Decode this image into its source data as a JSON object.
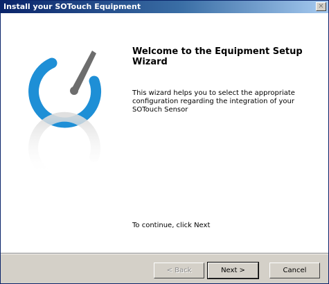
{
  "window": {
    "title": "Install your SOTouch Equipment",
    "close_glyph": "✕"
  },
  "main": {
    "heading": "Welcome to the Equipment Setup Wizard",
    "description": "This wizard helps you to select the appropriate configuration regarding the integration of your SOTouch Sensor",
    "continue_text": "To continue, click Next"
  },
  "footer": {
    "back_label": "< Back",
    "next_label": "Next >",
    "cancel_label": "Cancel"
  },
  "logo": {
    "icon": "sotouch-logo-icon",
    "arc_color": "#1e8fd6",
    "needle_color": "#6d6d6d"
  }
}
